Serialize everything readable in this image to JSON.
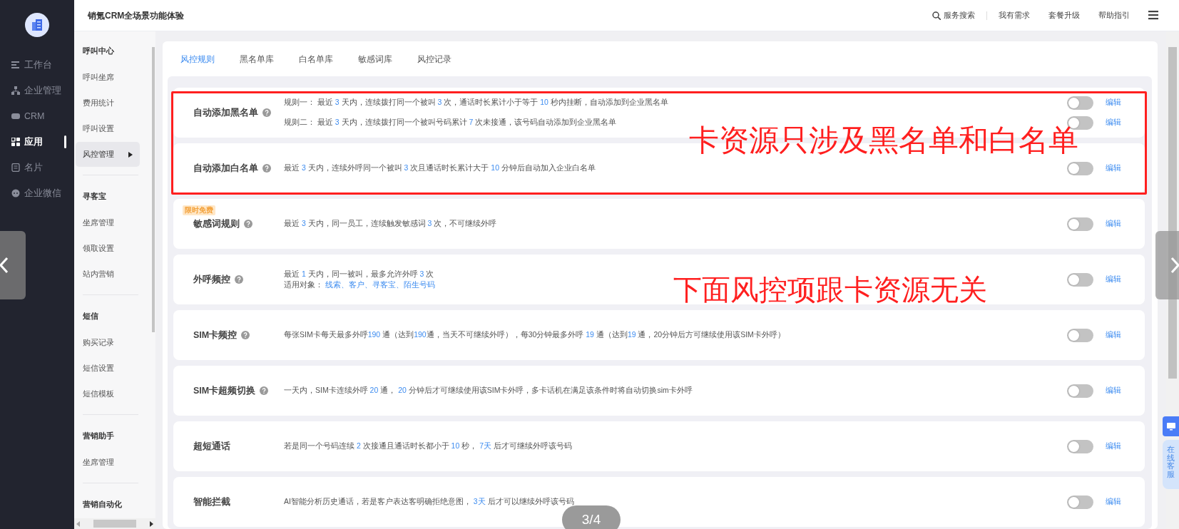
{
  "sidebar": {
    "items": [
      {
        "label": "工作台",
        "selected": false
      },
      {
        "label": "企业管理",
        "selected": false
      },
      {
        "label": "CRM",
        "selected": false
      },
      {
        "label": "应用",
        "selected": true
      },
      {
        "label": "名片",
        "selected": false
      },
      {
        "label": "企业微信",
        "selected": false
      }
    ]
  },
  "header": {
    "title": "销氪CRM全场景功能体验",
    "search_label": "服务搜索",
    "links": [
      "我有需求",
      "套餐升级",
      "帮助指引"
    ]
  },
  "subnav": [
    {
      "heading": "呼叫中心",
      "items": [
        {
          "label": "呼叫坐席",
          "selected": false
        },
        {
          "label": "费用统计",
          "selected": false
        },
        {
          "label": "呼叫设置",
          "selected": false
        },
        {
          "label": "风控管理",
          "selected": true
        }
      ]
    },
    {
      "heading": "寻客宝",
      "items": [
        {
          "label": "坐席管理",
          "selected": false
        },
        {
          "label": "领取设置",
          "selected": false
        },
        {
          "label": "站内营销",
          "selected": false
        }
      ]
    },
    {
      "heading": "短信",
      "items": [
        {
          "label": "购买记录",
          "selected": false
        },
        {
          "label": "短信设置",
          "selected": false
        },
        {
          "label": "短信模板",
          "selected": false
        }
      ]
    },
    {
      "heading": "营销助手",
      "items": [
        {
          "label": "坐席管理",
          "selected": false
        }
      ]
    },
    {
      "heading": "营销自动化"
    }
  ],
  "tabs": [
    {
      "label": "风控规则",
      "selected": true
    },
    {
      "label": "黑名单库",
      "selected": false
    },
    {
      "label": "白名单库",
      "selected": false
    },
    {
      "label": "敏感词库",
      "selected": false
    },
    {
      "label": "风控记录",
      "selected": false
    }
  ],
  "rows": [
    {
      "title": "自动添加黑名单",
      "help": true,
      "rules": [
        {
          "lines": [
            [
              {
                "text": "规则一： 最近 ",
                "highlight": false
              },
              {
                "text": "3",
                "highlight": true
              },
              {
                "text": " 天内，连续拨打同一个被叫 ",
                "highlight": false
              },
              {
                "text": "3",
                "highlight": true
              },
              {
                "text": " 次，通话时长累计小于等于 ",
                "highlight": false
              },
              {
                "text": "10",
                "highlight": true
              },
              {
                "text": " 秒内挂断，自动添加到企业黑名单",
                "highlight": false
              }
            ]
          ],
          "on": false,
          "edit": "编辑"
        },
        {
          "lines": [
            [
              {
                "text": "规则二： 最近 ",
                "highlight": false
              },
              {
                "text": "3",
                "highlight": true
              },
              {
                "text": " 天内，连续拨打同一个被叫号码累计 ",
                "highlight": false
              },
              {
                "text": "7",
                "highlight": true
              },
              {
                "text": " 次未接通，该号码自动添加到企业黑名单",
                "highlight": false
              }
            ]
          ],
          "on": false,
          "edit": "编辑"
        }
      ]
    },
    {
      "title": "自动添加白名单",
      "help": true,
      "rules": [
        {
          "lines": [
            [
              {
                "text": "最近 ",
                "highlight": false
              },
              {
                "text": "3",
                "highlight": true
              },
              {
                "text": " 天内，连续外呼同一个被叫 ",
                "highlight": false
              },
              {
                "text": "3",
                "highlight": true
              },
              {
                "text": " 次且通话时长累计大于 ",
                "highlight": false
              },
              {
                "text": "10",
                "highlight": true
              },
              {
                "text": " 分钟后自动加入企业白名单",
                "highlight": false
              }
            ]
          ],
          "on": false,
          "edit": "编辑"
        }
      ]
    },
    {
      "title": "敏感词规则",
      "badge": "限时免费",
      "help": true,
      "rules": [
        {
          "lines": [
            [
              {
                "text": "最近 ",
                "highlight": false
              },
              {
                "text": "3",
                "highlight": true
              },
              {
                "text": " 天内，同一员工，连续触发敏感词 ",
                "highlight": false
              },
              {
                "text": "3",
                "highlight": true
              },
              {
                "text": " 次，不可继续外呼",
                "highlight": false
              }
            ]
          ],
          "on": false,
          "edit": "编辑"
        }
      ]
    },
    {
      "title": "外呼频控",
      "help": true,
      "rules": [
        {
          "lines": [
            [
              {
                "text": "最近 ",
                "highlight": false
              },
              {
                "text": "1",
                "highlight": true
              },
              {
                "text": " 天内，同一被叫，最多允许外呼 ",
                "highlight": false
              },
              {
                "text": "3",
                "highlight": true
              },
              {
                "text": " 次",
                "highlight": false
              }
            ],
            [
              {
                "text": "适用对象： ",
                "highlight": false
              },
              {
                "text": "线索、客户、寻客宝、陌生号码",
                "highlight": true
              }
            ]
          ],
          "on": false,
          "edit": "编辑"
        }
      ]
    },
    {
      "title": "SIM卡频控",
      "help": true,
      "rules": [
        {
          "lines": [
            [
              {
                "text": "每张SIM卡每天最多外呼",
                "highlight": false
              },
              {
                "text": "190",
                "highlight": true
              },
              {
                "text": " 通（达到",
                "highlight": false
              },
              {
                "text": "190",
                "highlight": true
              },
              {
                "text": "通，当天不可继续外呼），每30分钟最多外呼 ",
                "highlight": false
              },
              {
                "text": "19",
                "highlight": true
              },
              {
                "text": " 通（达到",
                "highlight": false
              },
              {
                "text": "19",
                "highlight": true
              },
              {
                "text": " 通，20分钟后方可继续使用该SIM卡外呼）",
                "highlight": false
              }
            ]
          ],
          "on": false,
          "edit": "编辑"
        }
      ]
    },
    {
      "title": "SIM卡超频切换",
      "help": true,
      "rules": [
        {
          "lines": [
            [
              {
                "text": "一天内，SIM卡连续外呼 ",
                "highlight": false
              },
              {
                "text": "20",
                "highlight": true
              },
              {
                "text": " 通， ",
                "highlight": false
              },
              {
                "text": "20",
                "highlight": true
              },
              {
                "text": " 分钟后才可继续使用该SIM卡外呼，多卡话机在满足该条件时将自动切换sim卡外呼",
                "highlight": false
              }
            ]
          ],
          "on": false,
          "edit": "编辑"
        }
      ]
    },
    {
      "title": "超短通话",
      "help": false,
      "rules": [
        {
          "lines": [
            [
              {
                "text": "若是同一个号码连续 ",
                "highlight": false
              },
              {
                "text": "2",
                "highlight": true
              },
              {
                "text": " 次接通且通话时长都小于 ",
                "highlight": false
              },
              {
                "text": "10",
                "highlight": true
              },
              {
                "text": " 秒， ",
                "highlight": false
              },
              {
                "text": "7天",
                "highlight": true
              },
              {
                "text": " 后才可继续外呼该号码",
                "highlight": false
              }
            ]
          ],
          "on": false,
          "edit": "编辑"
        }
      ]
    },
    {
      "title": "智能拦截",
      "help": false,
      "rules": [
        {
          "lines": [
            [
              {
                "text": "AI智能分析历史通话，若是客户表达客明确拒绝意图， ",
                "highlight": false
              },
              {
                "text": "3天",
                "highlight": true
              },
              {
                "text": " 后才可以继续外呼该号码",
                "highlight": false
              }
            ]
          ],
          "on": false,
          "edit": "编辑"
        }
      ]
    }
  ],
  "support_widget": {
    "label": "在线客服"
  },
  "annotation_box": {
    "label": "卡资源只涉及黑名单和白名单"
  },
  "annotation_note": "下面风控项跟卡资源无关",
  "viewer": {
    "counter": "3/4"
  }
}
